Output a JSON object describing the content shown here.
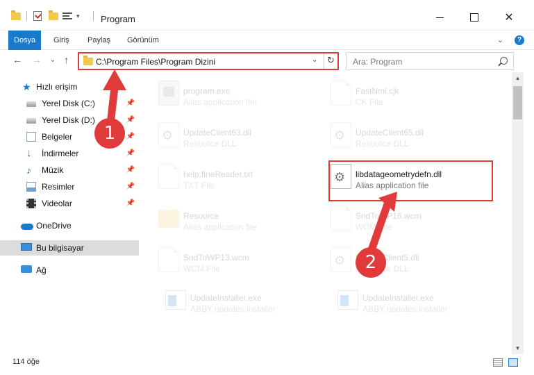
{
  "window": {
    "title": "Program",
    "min_label": "—",
    "max_label": "",
    "close_label": "✕"
  },
  "ribbon": {
    "tabs": [
      "Dosya",
      "Giriş",
      "Paylaş",
      "Görünüm"
    ],
    "chevron": "⌄",
    "help": "?"
  },
  "nav": {
    "back": "←",
    "forward": "→",
    "dropdown": "⌄",
    "up": "↑",
    "address": "C:\\Program Files\\Program Dizini",
    "address_dropdown": "⌄",
    "refresh": "↻",
    "search_placeholder": "Ara: Program"
  },
  "sidebar": {
    "items": [
      {
        "label": "Hızlı erişim",
        "icon": "star-icon",
        "pinned": false
      },
      {
        "label": "Yerel Disk (C:)",
        "icon": "drive-icon",
        "pinned": true
      },
      {
        "label": "Yerel Disk (D:)",
        "icon": "drive-icon",
        "pinned": true
      },
      {
        "label": "Belgeler",
        "icon": "document-icon",
        "pinned": true
      },
      {
        "label": "İndirmeler",
        "icon": "download-icon",
        "pinned": true
      },
      {
        "label": "Müzik",
        "icon": "music-icon",
        "pinned": true
      },
      {
        "label": "Resimler",
        "icon": "picture-icon",
        "pinned": true
      },
      {
        "label": "Videolar",
        "icon": "video-icon",
        "pinned": true
      },
      {
        "label": "OneDrive",
        "icon": "cloud-icon",
        "pinned": false
      },
      {
        "label": "Bu bilgisayar",
        "icon": "computer-icon",
        "pinned": false,
        "selected": true
      },
      {
        "label": "Ağ",
        "icon": "network-icon",
        "pinned": false
      }
    ],
    "pin_glyph": "📌"
  },
  "files": [
    {
      "name": "program.exe",
      "type": "Alias application file",
      "icon": "exe-icon",
      "highlighted": false
    },
    {
      "name": "FastNml.cjk",
      "type": "CK File",
      "icon": "page-icon",
      "highlighted": false
    },
    {
      "name": "UpdateClient63.dll",
      "type": "Resource DLL",
      "icon": "gear-file-icon",
      "highlighted": false
    },
    {
      "name": "UpdateClient65.dll",
      "type": "Resource DLL",
      "icon": "gear-file-icon",
      "highlighted": false
    },
    {
      "name": "help.fineReader.txt",
      "type": "TXT File",
      "icon": "page-icon",
      "highlighted": false
    },
    {
      "name": "libdatageometrydefn.dll",
      "type": "Alias application file",
      "icon": "gear-file-icon",
      "highlighted": true
    },
    {
      "name": "Resource",
      "type": "Alias application file",
      "icon": "folder-icon",
      "highlighted": false
    },
    {
      "name": "SndToWP16.wcm",
      "type": "WCM File",
      "icon": "page-icon",
      "highlighted": false
    },
    {
      "name": "SndToWP13.wcm",
      "type": "WCM File",
      "icon": "page-icon",
      "highlighted": false
    },
    {
      "name": "UpdateClient5.dll",
      "type": "Resource DLL",
      "icon": "gear-file-icon",
      "highlighted": false
    },
    {
      "name": "UpdateInstaller.exe",
      "type": "ABBY updates installer",
      "icon": "app-icon",
      "highlighted": false
    },
    {
      "name": "UpdateInstaller.exe",
      "type": "ABBY updates installer",
      "icon": "app-icon",
      "highlighted": false
    }
  ],
  "status": {
    "count": "114 öğe"
  },
  "markers": [
    "1",
    "2"
  ],
  "colors": {
    "accent": "#1979ca",
    "annotation": "#e03a3a"
  }
}
